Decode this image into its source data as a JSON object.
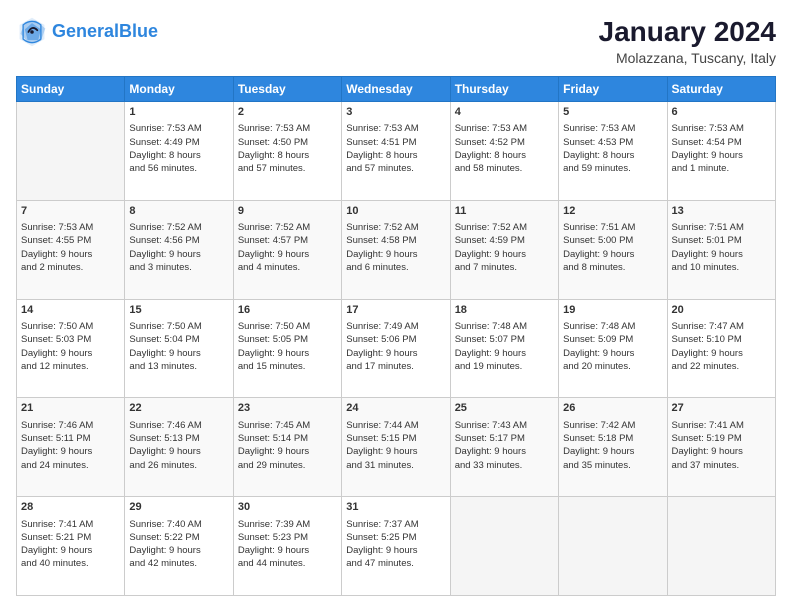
{
  "header": {
    "logo_line1": "General",
    "logo_line2": "Blue",
    "month_year": "January 2024",
    "location": "Molazzana, Tuscany, Italy"
  },
  "weekdays": [
    "Sunday",
    "Monday",
    "Tuesday",
    "Wednesday",
    "Thursday",
    "Friday",
    "Saturday"
  ],
  "weeks": [
    [
      {
        "day": "",
        "content": ""
      },
      {
        "day": "1",
        "content": "Sunrise: 7:53 AM\nSunset: 4:49 PM\nDaylight: 8 hours\nand 56 minutes."
      },
      {
        "day": "2",
        "content": "Sunrise: 7:53 AM\nSunset: 4:50 PM\nDaylight: 8 hours\nand 57 minutes."
      },
      {
        "day": "3",
        "content": "Sunrise: 7:53 AM\nSunset: 4:51 PM\nDaylight: 8 hours\nand 57 minutes."
      },
      {
        "day": "4",
        "content": "Sunrise: 7:53 AM\nSunset: 4:52 PM\nDaylight: 8 hours\nand 58 minutes."
      },
      {
        "day": "5",
        "content": "Sunrise: 7:53 AM\nSunset: 4:53 PM\nDaylight: 8 hours\nand 59 minutes."
      },
      {
        "day": "6",
        "content": "Sunrise: 7:53 AM\nSunset: 4:54 PM\nDaylight: 9 hours\nand 1 minute."
      }
    ],
    [
      {
        "day": "7",
        "content": "Sunrise: 7:53 AM\nSunset: 4:55 PM\nDaylight: 9 hours\nand 2 minutes."
      },
      {
        "day": "8",
        "content": "Sunrise: 7:52 AM\nSunset: 4:56 PM\nDaylight: 9 hours\nand 3 minutes."
      },
      {
        "day": "9",
        "content": "Sunrise: 7:52 AM\nSunset: 4:57 PM\nDaylight: 9 hours\nand 4 minutes."
      },
      {
        "day": "10",
        "content": "Sunrise: 7:52 AM\nSunset: 4:58 PM\nDaylight: 9 hours\nand 6 minutes."
      },
      {
        "day": "11",
        "content": "Sunrise: 7:52 AM\nSunset: 4:59 PM\nDaylight: 9 hours\nand 7 minutes."
      },
      {
        "day": "12",
        "content": "Sunrise: 7:51 AM\nSunset: 5:00 PM\nDaylight: 9 hours\nand 8 minutes."
      },
      {
        "day": "13",
        "content": "Sunrise: 7:51 AM\nSunset: 5:01 PM\nDaylight: 9 hours\nand 10 minutes."
      }
    ],
    [
      {
        "day": "14",
        "content": "Sunrise: 7:50 AM\nSunset: 5:03 PM\nDaylight: 9 hours\nand 12 minutes."
      },
      {
        "day": "15",
        "content": "Sunrise: 7:50 AM\nSunset: 5:04 PM\nDaylight: 9 hours\nand 13 minutes."
      },
      {
        "day": "16",
        "content": "Sunrise: 7:50 AM\nSunset: 5:05 PM\nDaylight: 9 hours\nand 15 minutes."
      },
      {
        "day": "17",
        "content": "Sunrise: 7:49 AM\nSunset: 5:06 PM\nDaylight: 9 hours\nand 17 minutes."
      },
      {
        "day": "18",
        "content": "Sunrise: 7:48 AM\nSunset: 5:07 PM\nDaylight: 9 hours\nand 19 minutes."
      },
      {
        "day": "19",
        "content": "Sunrise: 7:48 AM\nSunset: 5:09 PM\nDaylight: 9 hours\nand 20 minutes."
      },
      {
        "day": "20",
        "content": "Sunrise: 7:47 AM\nSunset: 5:10 PM\nDaylight: 9 hours\nand 22 minutes."
      }
    ],
    [
      {
        "day": "21",
        "content": "Sunrise: 7:46 AM\nSunset: 5:11 PM\nDaylight: 9 hours\nand 24 minutes."
      },
      {
        "day": "22",
        "content": "Sunrise: 7:46 AM\nSunset: 5:13 PM\nDaylight: 9 hours\nand 26 minutes."
      },
      {
        "day": "23",
        "content": "Sunrise: 7:45 AM\nSunset: 5:14 PM\nDaylight: 9 hours\nand 29 minutes."
      },
      {
        "day": "24",
        "content": "Sunrise: 7:44 AM\nSunset: 5:15 PM\nDaylight: 9 hours\nand 31 minutes."
      },
      {
        "day": "25",
        "content": "Sunrise: 7:43 AM\nSunset: 5:17 PM\nDaylight: 9 hours\nand 33 minutes."
      },
      {
        "day": "26",
        "content": "Sunrise: 7:42 AM\nSunset: 5:18 PM\nDaylight: 9 hours\nand 35 minutes."
      },
      {
        "day": "27",
        "content": "Sunrise: 7:41 AM\nSunset: 5:19 PM\nDaylight: 9 hours\nand 37 minutes."
      }
    ],
    [
      {
        "day": "28",
        "content": "Sunrise: 7:41 AM\nSunset: 5:21 PM\nDaylight: 9 hours\nand 40 minutes."
      },
      {
        "day": "29",
        "content": "Sunrise: 7:40 AM\nSunset: 5:22 PM\nDaylight: 9 hours\nand 42 minutes."
      },
      {
        "day": "30",
        "content": "Sunrise: 7:39 AM\nSunset: 5:23 PM\nDaylight: 9 hours\nand 44 minutes."
      },
      {
        "day": "31",
        "content": "Sunrise: 7:37 AM\nSunset: 5:25 PM\nDaylight: 9 hours\nand 47 minutes."
      },
      {
        "day": "",
        "content": ""
      },
      {
        "day": "",
        "content": ""
      },
      {
        "day": "",
        "content": ""
      }
    ]
  ]
}
